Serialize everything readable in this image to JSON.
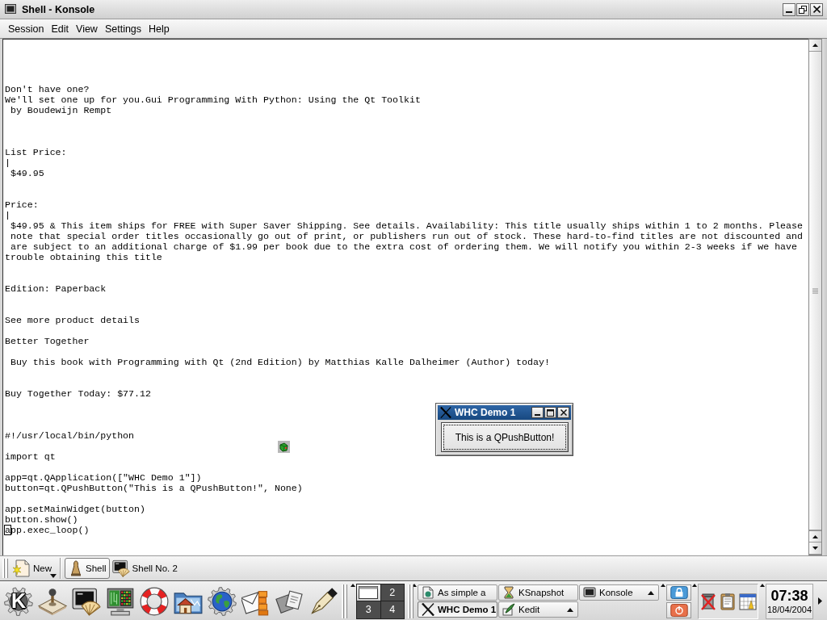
{
  "window": {
    "title": "Shell - Konsole",
    "active": false
  },
  "menu_bar": [
    "Session",
    "Edit",
    "View",
    "Settings",
    "Help"
  ],
  "terminal": {
    "output": "Don't have one?\nWe'll set one up for you.Gui Programming With Python: Using the Qt Toolkit\n by Boudewijn Rempt\n\n\n\nList Price:\n|\n $49.95\n\n\nPrice:\n|\n $49.95 & This item ships for FREE with Super Saver Shipping. See details. Availability: This title usually ships within 1 to 2 months. Please\n note that special order titles occasionally go out of print, or publishers run out of stock. These hard-to-find titles are not discounted and\n are subject to an additional charge of $1.99 per book due to the extra cost of ordering them. We will notify you within 2-3 weeks if we have\ntrouble obtaining this title\n\n\nEdition: Paperback\n\n\nSee more product details\n\nBetter Together\n\n Buy this book with Programming with Qt (2nd Edition) by Matthias Kalle Dalheimer (Author) today!\n\n\nBuy Together Today: $77.12\n\n\n\n#!/usr/local/bin/python\n\nimport qt\n\napp=qt.QApplication([\"WHC Demo 1\"])\nbutton=qt.QPushButton(\"This is a QPushButton!\", None)\n\napp.setMainWidget(button)\nbutton.show()",
    "last_line": {
      "text": "app.exec_loop()",
      "cursor": true
    }
  },
  "session_tabs": {
    "new_button": "New",
    "tabs": [
      {
        "label": "Shell",
        "selected": true
      },
      {
        "label": "Shell No. 2",
        "selected": false
      }
    ]
  },
  "dialog": {
    "title": "WHC Demo 1",
    "active": true,
    "button": {
      "label": "This is a QPushButton!",
      "focused": true
    }
  },
  "panel": {
    "k_menu": "K",
    "pager": [
      {
        "selected": true,
        "has_windows": true
      },
      {
        "label": "2",
        "selected": false,
        "has_windows": false
      },
      {
        "label": "3",
        "selected": false,
        "has_windows": false
      },
      {
        "label": "4",
        "selected": false,
        "has_windows": false
      }
    ],
    "tasks": [
      {
        "label": "As simple a",
        "selected": false,
        "grouped": false
      },
      {
        "label": "KSnapshot",
        "selected": false,
        "grouped": false
      },
      {
        "label": "Konsole",
        "selected": false,
        "grouped": true
      },
      {
        "label": "WHC Demo 1",
        "selected": true,
        "grouped": false
      },
      {
        "label": "Kedit",
        "selected": false,
        "grouped": true
      }
    ],
    "clock": {
      "time": "07:38",
      "date": "18/04/2004"
    }
  }
}
